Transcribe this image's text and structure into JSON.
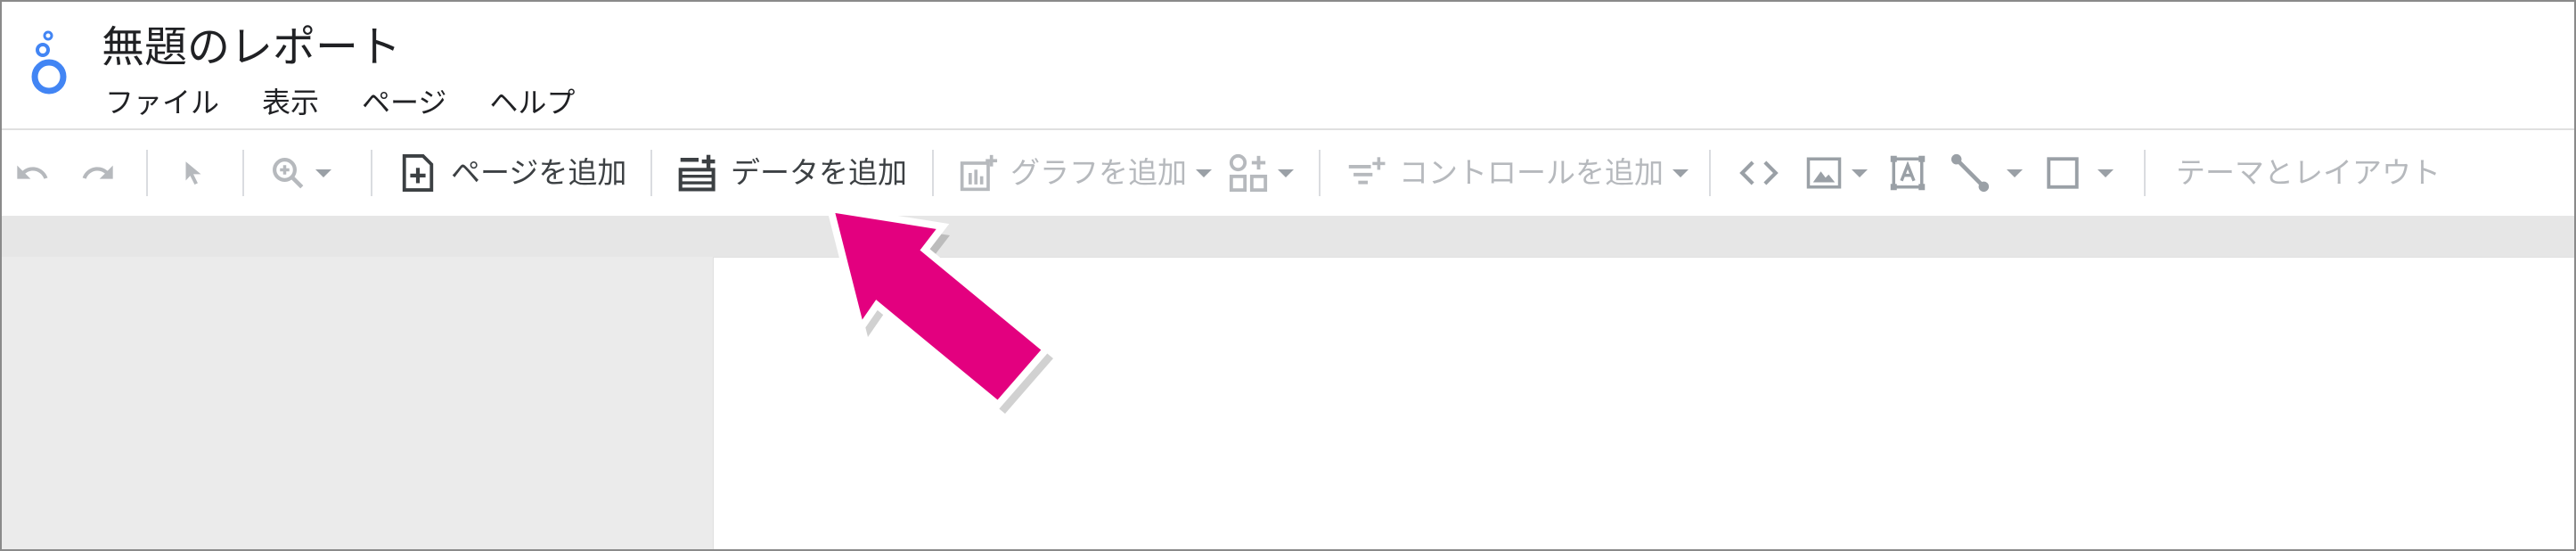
{
  "app": {
    "title": "無題のレポート"
  },
  "menu": {
    "items": [
      "ファイル",
      "表示",
      "ページ",
      "ヘルプ"
    ]
  },
  "toolbar": {
    "add_page_label": "ページを追加",
    "add_data_label": "データを追加",
    "add_chart_label": "グラフを追加",
    "add_control_label": "コントロールを追加",
    "theme_layout_label": "テーマとレイアウト"
  },
  "colors": {
    "logo_blue": "#4285f4",
    "callout_arrow": "#e3007f",
    "toolbar_dark": "#3c4043",
    "toolbar_disabled": "#b6b9bd",
    "canvas_gray": "#ebebeb"
  },
  "icons": [
    "looker-studio-logo-icon",
    "undo-icon",
    "redo-icon",
    "select-pointer-icon",
    "zoom-icon",
    "add-page-icon",
    "add-data-icon",
    "add-chart-icon",
    "community-viz-icon",
    "add-control-icon",
    "embed-code-icon",
    "image-icon",
    "text-box-icon",
    "line-icon",
    "shape-icon",
    "callout-arrow-icon"
  ]
}
